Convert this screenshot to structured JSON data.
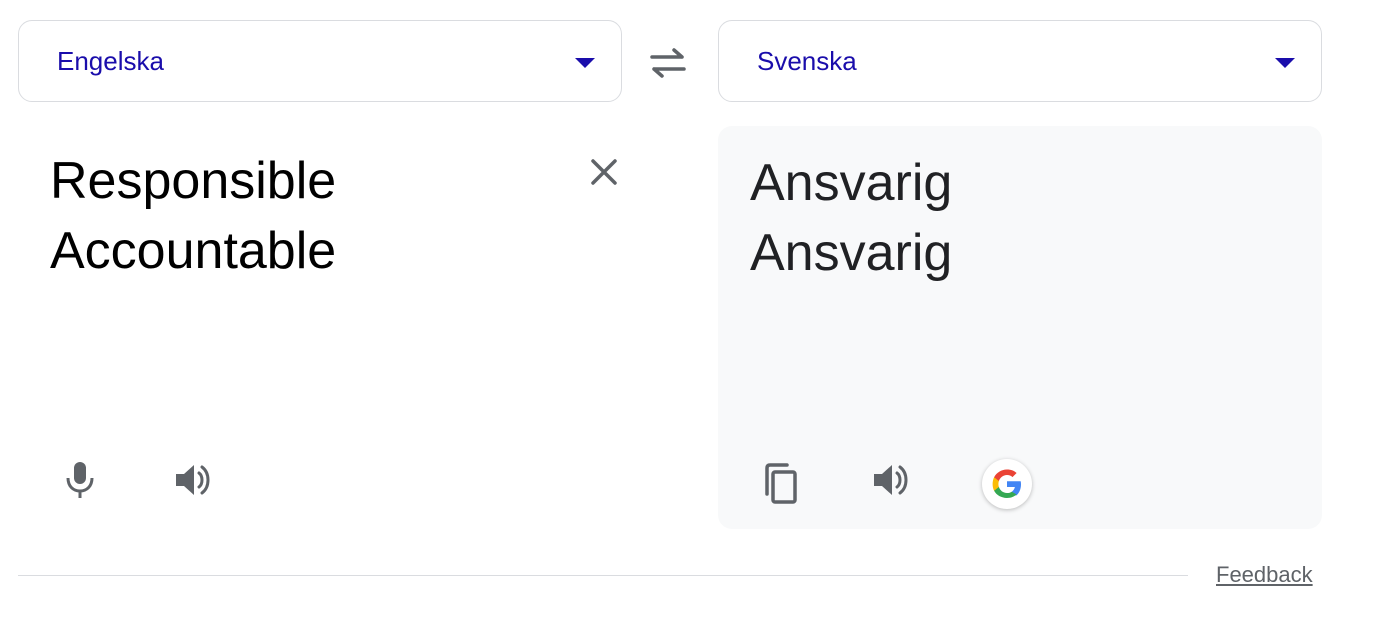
{
  "source": {
    "language": "Engelska",
    "text": "Responsible\nAccountable"
  },
  "target": {
    "language": "Svenska",
    "text": "Ansvarig\nAnsvarig"
  },
  "footer": {
    "feedback_label": "Feedback"
  },
  "colors": {
    "language_label": "#1a0dab",
    "icon_gray": "#5f6368",
    "panel_bg": "#f8f9fa",
    "border": "#dadce0"
  }
}
